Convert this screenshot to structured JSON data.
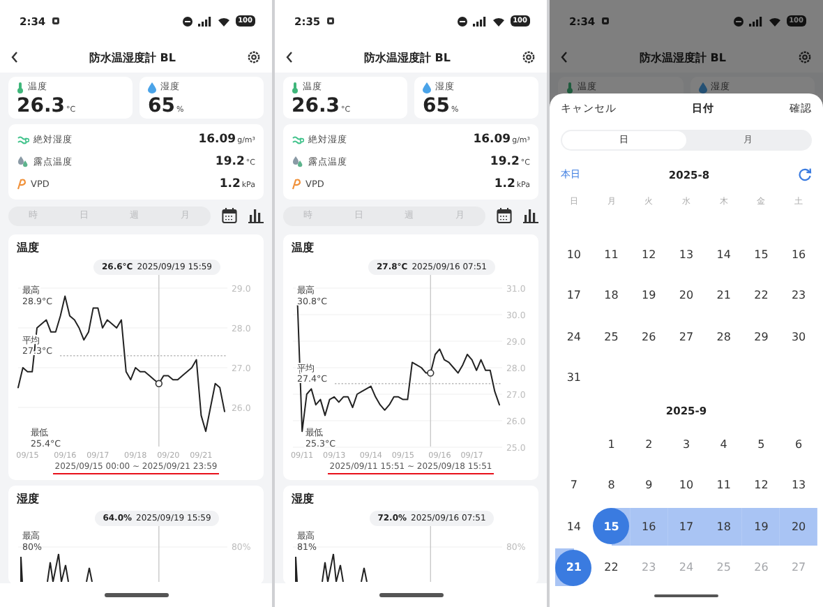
{
  "screens": [
    {
      "kind": "detail",
      "status": {
        "time": "2:34",
        "battery": "100"
      },
      "title": "防水温湿度計 BL",
      "current": [
        {
          "kind": "temp",
          "label": "温度",
          "value": "26.3",
          "unit": "°C"
        },
        {
          "kind": "humidity",
          "label": "湿度",
          "value": "65",
          "unit": "%"
        }
      ],
      "metrics": [
        {
          "kind": "absolute",
          "label": "絶対湿度",
          "value": "16.09",
          "unit": "g/m³"
        },
        {
          "kind": "dew",
          "label": "露点温度",
          "value": "19.2",
          "unit": "°C"
        },
        {
          "kind": "vpd",
          "label": "VPD",
          "value": "1.2",
          "unit": "kPa"
        }
      ],
      "periods": [
        {
          "label": "時",
          "selected": false
        },
        {
          "label": "日",
          "selected": false
        },
        {
          "label": "週",
          "selected": false
        },
        {
          "label": "月",
          "selected": false
        }
      ],
      "temperature_chart": {
        "title": "温度",
        "tooltip_value": "26.6°C",
        "tooltip_time": "2025/09/19 15:59",
        "max_label": "最高",
        "max_value": "28.9°C",
        "avg_label": "平均",
        "min_label": "最低",
        "min_value": "25.4°C",
        "range": "2025/09/15 00:00 ~ 2025/09/21 23:59",
        "chart_data": {
          "type": "line",
          "categories": [
            null,
            null,
            "09/15",
            null,
            null,
            null,
            null,
            null,
            null,
            null,
            "09/16",
            null,
            null,
            null,
            null,
            null,
            null,
            "09/17",
            null,
            null,
            null,
            null,
            null,
            null,
            null,
            "09/18",
            null,
            null,
            null,
            null,
            null,
            null,
            "09/20",
            null,
            null,
            null,
            null,
            null,
            null,
            "09/21",
            null,
            null,
            null,
            null,
            null
          ],
          "series": [
            {
              "color": "#222222",
              "values": [
                26.5,
                27.0,
                26.9,
                26.9,
                28.0,
                28.1,
                28.2,
                27.9,
                27.9,
                28.3,
                28.8,
                28.3,
                28.2,
                28.0,
                27.7,
                27.9,
                28.5,
                28.5,
                28.0,
                28.2,
                28.1,
                28.0,
                28.2,
                26.9,
                26.7,
                27.0,
                26.9,
                26.9,
                26.8,
                26.7,
                26.6,
                26.8,
                26.8,
                26.7,
                26.7,
                26.8,
                26.9,
                27.0,
                27.2,
                25.8,
                25.4,
                26.0,
                26.6,
                26.5,
                25.9
              ]
            },
            {
              "color": "#333333",
              "marker": true,
              "values": [
                null,
                null,
                null,
                null,
                null,
                null,
                null,
                null,
                null,
                null,
                null,
                null,
                null,
                null,
                null,
                null,
                null,
                null,
                null,
                null,
                null,
                null,
                null,
                null,
                null,
                null,
                null,
                null,
                null,
                null,
                26.6,
                null,
                null,
                null,
                null,
                null,
                null,
                null,
                null,
                null,
                null,
                null,
                null,
                null,
                null
              ]
            }
          ],
          "grid": true,
          "ylim": [
            25.0,
            29.0
          ],
          "yticks": [
            {
              "value": 26,
              "label": "26.0"
            },
            {
              "value": 27,
              "label": "27.0"
            },
            {
              "value": 28,
              "label": "28.0"
            },
            {
              "value": 29,
              "label": "29.0"
            }
          ],
          "ref_lines": [
            {
              "axis": "y",
              "value": 27.3,
              "label": "27.3°C"
            }
          ]
        }
      },
      "humidity_chart": {
        "title": "湿度",
        "tooltip_value": "64.0%",
        "tooltip_time": "2025/09/19 15:59",
        "max_label": "最高",
        "max_value": "80%",
        "ytick": "80%"
      }
    },
    {
      "kind": "detail",
      "status": {
        "time": "2:35",
        "battery": "100"
      },
      "title": "防水温湿度計 BL",
      "current": [
        {
          "kind": "temp",
          "label": "温度",
          "value": "26.3",
          "unit": "°C"
        },
        {
          "kind": "humidity",
          "label": "湿度",
          "value": "65",
          "unit": "%"
        }
      ],
      "metrics": [
        {
          "kind": "absolute",
          "label": "絶対湿度",
          "value": "16.09",
          "unit": "g/m³"
        },
        {
          "kind": "dew",
          "label": "露点温度",
          "value": "19.2",
          "unit": "°C"
        },
        {
          "kind": "vpd",
          "label": "VPD",
          "value": "1.2",
          "unit": "kPa"
        }
      ],
      "periods": [
        {
          "label": "時",
          "selected": false
        },
        {
          "label": "日",
          "selected": false
        },
        {
          "label": "週",
          "selected": false
        },
        {
          "label": "月",
          "selected": false
        }
      ],
      "temperature_chart": {
        "title": "温度",
        "tooltip_value": "27.8°C",
        "tooltip_time": "2025/09/16 07:51",
        "max_label": "最高",
        "max_value": "30.8°C",
        "avg_label": "平均",
        "min_label": "最低",
        "min_value": "25.3°C",
        "range": "2025/09/11 15:51 ~ 2025/09/18 15:51",
        "chart_data": {
          "type": "line",
          "categories": [
            null,
            null,
            "09/11",
            null,
            null,
            null,
            null,
            null,
            null,
            "09/13",
            null,
            null,
            null,
            null,
            null,
            null,
            null,
            "09/14",
            null,
            null,
            null,
            null,
            null,
            null,
            "09/15",
            null,
            null,
            null,
            null,
            null,
            null,
            null,
            "09/16",
            null,
            null,
            null,
            null,
            null,
            null,
            "09/17",
            null,
            null,
            null,
            null,
            null,
            null
          ],
          "series": [
            {
              "color": "#222222",
              "values": [
                null,
                30.4,
                25.6,
                27.0,
                27.2,
                26.6,
                26.8,
                26.2,
                26.8,
                26.9,
                26.7,
                26.9,
                26.9,
                26.5,
                27.0,
                27.1,
                27.2,
                27.3,
                26.9,
                26.6,
                26.4,
                26.6,
                26.9,
                26.9,
                26.8,
                26.8,
                28.2,
                28.1,
                28.0,
                27.8,
                27.8,
                28.5,
                28.7,
                28.3,
                28.2,
                28.0,
                27.8,
                28.1,
                28.5,
                28.3,
                27.9,
                28.3,
                27.9,
                27.9,
                27.1,
                26.6
              ]
            },
            {
              "color": "#333333",
              "marker": true,
              "values": [
                null,
                null,
                null,
                null,
                null,
                null,
                null,
                null,
                null,
                null,
                null,
                null,
                null,
                null,
                null,
                null,
                null,
                null,
                null,
                null,
                null,
                null,
                null,
                null,
                null,
                null,
                null,
                null,
                null,
                null,
                27.8,
                null,
                null,
                null,
                null,
                null,
                null,
                null,
                null,
                null,
                null,
                null,
                null,
                null,
                null,
                null
              ]
            }
          ],
          "grid": true,
          "ylim": [
            25.0,
            31.0
          ],
          "yticks": [
            {
              "value": 25,
              "label": "25.0"
            },
            {
              "value": 26,
              "label": "26.0"
            },
            {
              "value": 27,
              "label": "27.0"
            },
            {
              "value": 28,
              "label": "28.0"
            },
            {
              "value": 29,
              "label": "29.0"
            },
            {
              "value": 30,
              "label": "30.0"
            },
            {
              "value": 31,
              "label": "31.0"
            }
          ],
          "ref_lines": [
            {
              "axis": "y",
              "value": 27.4,
              "label": "27.4°C"
            }
          ]
        }
      },
      "humidity_chart": {
        "title": "湿度",
        "tooltip_value": "72.0%",
        "tooltip_time": "2025/09/16 07:51",
        "max_label": "最高",
        "max_value": "81%",
        "ytick": "80%"
      }
    },
    {
      "kind": "picker",
      "status": {
        "time": "2:34",
        "battery": "100"
      },
      "title": "防水温湿度計 BL",
      "current": [
        {
          "kind": "temp",
          "label": "温度"
        },
        {
          "kind": "humidity",
          "label": "湿度"
        }
      ],
      "sheet": {
        "cancel": "キャンセル",
        "title": "日付",
        "confirm": "確認",
        "modes": [
          {
            "label": "日",
            "selected": true
          },
          {
            "label": "月",
            "selected": false
          }
        ],
        "today": "本日",
        "weekdays": [
          "日",
          "月",
          "火",
          "水",
          "木",
          "金",
          "土"
        ],
        "months": [
          {
            "title": "2025-8",
            "weeks": [
              [
                {
                  "day": "10",
                  "selected": false,
                  "disabled": false
                },
                {
                  "day": "11",
                  "selected": false,
                  "disabled": false
                },
                {
                  "day": "12",
                  "selected": false,
                  "disabled": false
                },
                {
                  "day": "13",
                  "selected": false,
                  "disabled": false
                },
                {
                  "day": "14",
                  "selected": false,
                  "disabled": false
                },
                {
                  "day": "15",
                  "selected": false,
                  "disabled": false
                },
                {
                  "day": "16",
                  "selected": false,
                  "disabled": false
                }
              ],
              [
                {
                  "day": "17",
                  "selected": false,
                  "disabled": false
                },
                {
                  "day": "18",
                  "selected": false,
                  "disabled": false
                },
                {
                  "day": "19",
                  "selected": false,
                  "disabled": false
                },
                {
                  "day": "20",
                  "selected": false,
                  "disabled": false
                },
                {
                  "day": "21",
                  "selected": false,
                  "disabled": false
                },
                {
                  "day": "22",
                  "selected": false,
                  "disabled": false
                },
                {
                  "day": "23",
                  "selected": false,
                  "disabled": false
                }
              ],
              [
                {
                  "day": "24",
                  "selected": false,
                  "disabled": false
                },
                {
                  "day": "25",
                  "selected": false,
                  "disabled": false
                },
                {
                  "day": "26",
                  "selected": false,
                  "disabled": false
                },
                {
                  "day": "27",
                  "selected": false,
                  "disabled": false
                },
                {
                  "day": "28",
                  "selected": false,
                  "disabled": false
                },
                {
                  "day": "29",
                  "selected": false,
                  "disabled": false
                },
                {
                  "day": "30",
                  "selected": false,
                  "disabled": false
                }
              ],
              [
                {
                  "day": "31",
                  "selected": false,
                  "disabled": false
                }
              ]
            ]
          },
          {
            "title": "2025-9",
            "weeks": [
              [
                {
                  "day": "1",
                  "selected": false,
                  "disabled": false
                },
                {
                  "day": "2",
                  "selected": false,
                  "disabled": false
                },
                {
                  "day": "3",
                  "selected": false,
                  "disabled": false
                },
                {
                  "day": "4",
                  "selected": false,
                  "disabled": false
                },
                {
                  "day": "5",
                  "selected": false,
                  "disabled": false
                },
                {
                  "day": "6",
                  "selected": false,
                  "disabled": false
                }
              ],
              [
                {
                  "day": "7",
                  "selected": false,
                  "disabled": false
                },
                {
                  "day": "8",
                  "selected": false,
                  "disabled": false
                },
                {
                  "day": "9",
                  "selected": false,
                  "disabled": false
                },
                {
                  "day": "10",
                  "selected": false,
                  "disabled": false
                },
                {
                  "day": "11",
                  "selected": false,
                  "disabled": false
                },
                {
                  "day": "12",
                  "selected": false,
                  "disabled": false
                },
                {
                  "day": "13",
                  "selected": false,
                  "disabled": false
                }
              ],
              [
                {
                  "day": "14",
                  "selected": false,
                  "disabled": false
                },
                {
                  "day": "15",
                  "selected": true,
                  "disabled": false,
                  "kind": "range_start"
                },
                {
                  "day": "16",
                  "selected": false,
                  "disabled": false,
                  "kind": "range_middle"
                },
                {
                  "day": "17",
                  "selected": false,
                  "disabled": false,
                  "kind": "range_middle"
                },
                {
                  "day": "18",
                  "selected": false,
                  "disabled": false,
                  "kind": "range_middle"
                },
                {
                  "day": "19",
                  "selected": false,
                  "disabled": false,
                  "kind": "range_middle"
                },
                {
                  "day": "20",
                  "selected": false,
                  "disabled": false,
                  "kind": "range_middle"
                }
              ],
              [
                {
                  "day": "21",
                  "selected": true,
                  "disabled": false,
                  "kind": "range_end"
                },
                {
                  "day": "22",
                  "selected": false,
                  "disabled": false
                },
                {
                  "day": "23",
                  "selected": false,
                  "disabled": true
                },
                {
                  "day": "24",
                  "selected": false,
                  "disabled": true
                },
                {
                  "day": "25",
                  "selected": false,
                  "disabled": true
                },
                {
                  "day": "26",
                  "selected": false,
                  "disabled": true
                },
                {
                  "day": "27",
                  "selected": false,
                  "disabled": true
                }
              ]
            ]
          }
        ]
      }
    }
  ]
}
